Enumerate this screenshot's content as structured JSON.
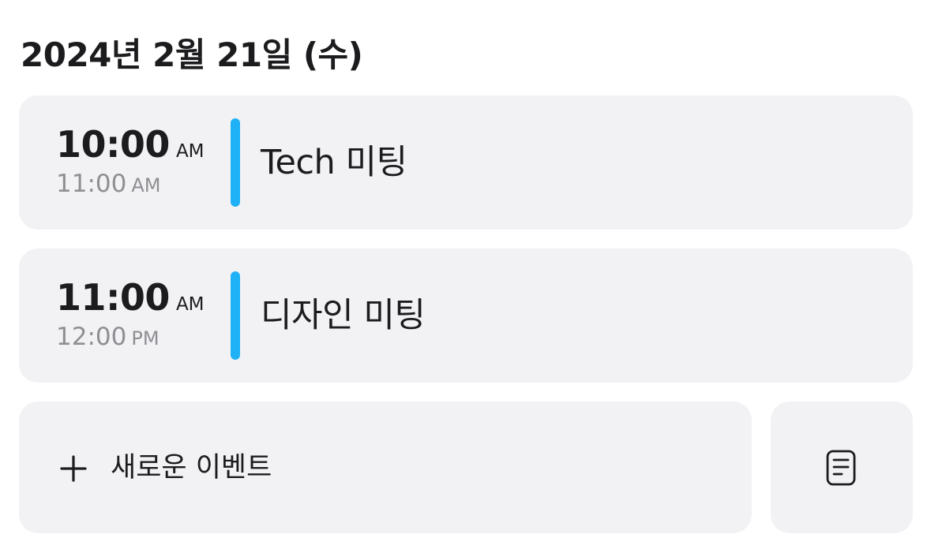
{
  "header": {
    "date_title": "2024년 2월 21일 (수)"
  },
  "events": [
    {
      "start_time": "10:00",
      "start_period": "AM",
      "end_time": "11:00",
      "end_period": "AM",
      "title": "Tech 미팅",
      "accent_color": "#1eb1f5"
    },
    {
      "start_time": "11:00",
      "start_period": "AM",
      "end_time": "12:00",
      "end_period": "PM",
      "title": "디자인 미팅",
      "accent_color": "#1eb1f5"
    }
  ],
  "actions": {
    "new_event_label": "새로운 이벤트",
    "new_event_icon": "plus-icon",
    "notes_icon": "notes-icon"
  },
  "colors": {
    "card_background": "#f2f2f5",
    "secondary_text": "#8e8e93",
    "accent": "#1eb1f5"
  }
}
